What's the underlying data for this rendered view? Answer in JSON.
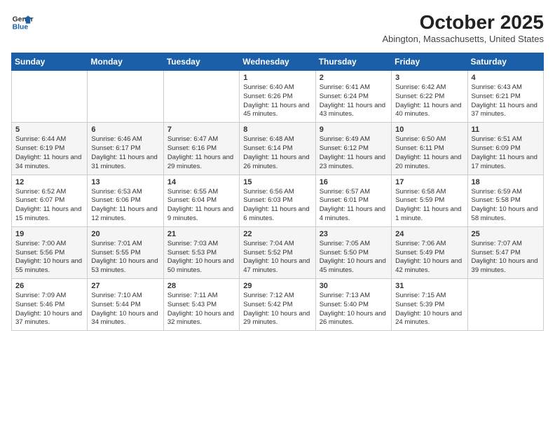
{
  "header": {
    "logo_line1": "General",
    "logo_line2": "Blue",
    "month": "October 2025",
    "location": "Abington, Massachusetts, United States"
  },
  "weekdays": [
    "Sunday",
    "Monday",
    "Tuesday",
    "Wednesday",
    "Thursday",
    "Friday",
    "Saturday"
  ],
  "weeks": [
    [
      {
        "day": "",
        "info": ""
      },
      {
        "day": "",
        "info": ""
      },
      {
        "day": "",
        "info": ""
      },
      {
        "day": "1",
        "info": "Sunrise: 6:40 AM\nSunset: 6:26 PM\nDaylight: 11 hours\nand 45 minutes."
      },
      {
        "day": "2",
        "info": "Sunrise: 6:41 AM\nSunset: 6:24 PM\nDaylight: 11 hours\nand 43 minutes."
      },
      {
        "day": "3",
        "info": "Sunrise: 6:42 AM\nSunset: 6:22 PM\nDaylight: 11 hours\nand 40 minutes."
      },
      {
        "day": "4",
        "info": "Sunrise: 6:43 AM\nSunset: 6:21 PM\nDaylight: 11 hours\nand 37 minutes."
      }
    ],
    [
      {
        "day": "5",
        "info": "Sunrise: 6:44 AM\nSunset: 6:19 PM\nDaylight: 11 hours\nand 34 minutes."
      },
      {
        "day": "6",
        "info": "Sunrise: 6:46 AM\nSunset: 6:17 PM\nDaylight: 11 hours\nand 31 minutes."
      },
      {
        "day": "7",
        "info": "Sunrise: 6:47 AM\nSunset: 6:16 PM\nDaylight: 11 hours\nand 29 minutes."
      },
      {
        "day": "8",
        "info": "Sunrise: 6:48 AM\nSunset: 6:14 PM\nDaylight: 11 hours\nand 26 minutes."
      },
      {
        "day": "9",
        "info": "Sunrise: 6:49 AM\nSunset: 6:12 PM\nDaylight: 11 hours\nand 23 minutes."
      },
      {
        "day": "10",
        "info": "Sunrise: 6:50 AM\nSunset: 6:11 PM\nDaylight: 11 hours\nand 20 minutes."
      },
      {
        "day": "11",
        "info": "Sunrise: 6:51 AM\nSunset: 6:09 PM\nDaylight: 11 hours\nand 17 minutes."
      }
    ],
    [
      {
        "day": "12",
        "info": "Sunrise: 6:52 AM\nSunset: 6:07 PM\nDaylight: 11 hours\nand 15 minutes."
      },
      {
        "day": "13",
        "info": "Sunrise: 6:53 AM\nSunset: 6:06 PM\nDaylight: 11 hours\nand 12 minutes."
      },
      {
        "day": "14",
        "info": "Sunrise: 6:55 AM\nSunset: 6:04 PM\nDaylight: 11 hours\nand 9 minutes."
      },
      {
        "day": "15",
        "info": "Sunrise: 6:56 AM\nSunset: 6:03 PM\nDaylight: 11 hours\nand 6 minutes."
      },
      {
        "day": "16",
        "info": "Sunrise: 6:57 AM\nSunset: 6:01 PM\nDaylight: 11 hours\nand 4 minutes."
      },
      {
        "day": "17",
        "info": "Sunrise: 6:58 AM\nSunset: 5:59 PM\nDaylight: 11 hours\nand 1 minute."
      },
      {
        "day": "18",
        "info": "Sunrise: 6:59 AM\nSunset: 5:58 PM\nDaylight: 10 hours\nand 58 minutes."
      }
    ],
    [
      {
        "day": "19",
        "info": "Sunrise: 7:00 AM\nSunset: 5:56 PM\nDaylight: 10 hours\nand 55 minutes."
      },
      {
        "day": "20",
        "info": "Sunrise: 7:01 AM\nSunset: 5:55 PM\nDaylight: 10 hours\nand 53 minutes."
      },
      {
        "day": "21",
        "info": "Sunrise: 7:03 AM\nSunset: 5:53 PM\nDaylight: 10 hours\nand 50 minutes."
      },
      {
        "day": "22",
        "info": "Sunrise: 7:04 AM\nSunset: 5:52 PM\nDaylight: 10 hours\nand 47 minutes."
      },
      {
        "day": "23",
        "info": "Sunrise: 7:05 AM\nSunset: 5:50 PM\nDaylight: 10 hours\nand 45 minutes."
      },
      {
        "day": "24",
        "info": "Sunrise: 7:06 AM\nSunset: 5:49 PM\nDaylight: 10 hours\nand 42 minutes."
      },
      {
        "day": "25",
        "info": "Sunrise: 7:07 AM\nSunset: 5:47 PM\nDaylight: 10 hours\nand 39 minutes."
      }
    ],
    [
      {
        "day": "26",
        "info": "Sunrise: 7:09 AM\nSunset: 5:46 PM\nDaylight: 10 hours\nand 37 minutes."
      },
      {
        "day": "27",
        "info": "Sunrise: 7:10 AM\nSunset: 5:44 PM\nDaylight: 10 hours\nand 34 minutes."
      },
      {
        "day": "28",
        "info": "Sunrise: 7:11 AM\nSunset: 5:43 PM\nDaylight: 10 hours\nand 32 minutes."
      },
      {
        "day": "29",
        "info": "Sunrise: 7:12 AM\nSunset: 5:42 PM\nDaylight: 10 hours\nand 29 minutes."
      },
      {
        "day": "30",
        "info": "Sunrise: 7:13 AM\nSunset: 5:40 PM\nDaylight: 10 hours\nand 26 minutes."
      },
      {
        "day": "31",
        "info": "Sunrise: 7:15 AM\nSunset: 5:39 PM\nDaylight: 10 hours\nand 24 minutes."
      },
      {
        "day": "",
        "info": ""
      }
    ]
  ]
}
